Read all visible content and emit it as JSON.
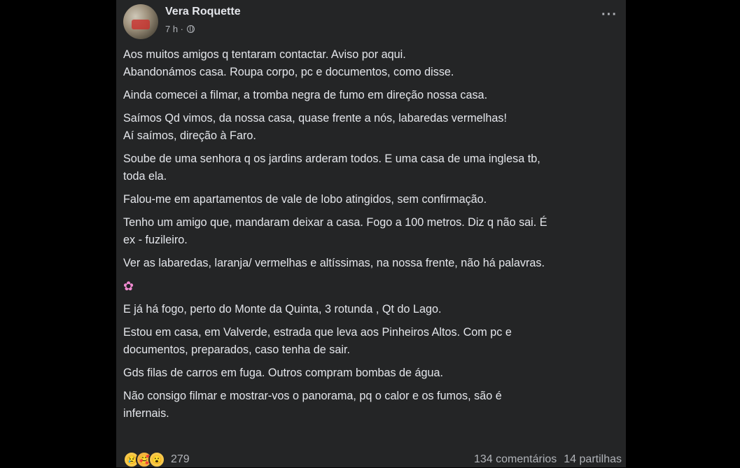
{
  "post": {
    "author": "Vera Roquette",
    "time": "7 h ·",
    "more_label": "···",
    "icons": {
      "avatar": "profile-photo",
      "privacy": "globe-icon",
      "reactions": [
        "sad-face-icon",
        "care-face-icon",
        "wow-face-icon"
      ],
      "section": "flower-icon"
    },
    "lines": [
      "Aos muitos amigos q tentaram contactar. Aviso por aqui.",
      "Abandonámos casa. Roupa corpo, pc e documentos, como disse.",
      "Ainda comecei a filmar, a tromba negra de fumo em direção nossa casa.",
      "Saímos Qd vimos, da nossa casa, quase frente a nós, labaredas vermelhas!",
      "Aí saímos, direção à Faro.",
      "Soube de uma senhora q os jardins arderam todos. E uma casa de uma inglesa tb,",
      "toda ela.",
      "Falou-me em apartamentos de vale de lobo atingidos, sem confirmação.",
      "Tenho um amigo que, mandaram deixar  a casa. Fogo a 100 metros. Diz q não sai. É",
      "ex - fuzileiro.",
      "Ver as labaredas, laranja/ vermelhas e altíssimas,  na nossa frente, não há palavras.",
      "✿",
      "E já  há fogo, perto do Monte da Quinta, 3 rotunda , Qt do Lago.",
      "Estou em casa, em Valverde, estrada que leva aos Pinheiros Altos. Com pc e",
      "documentos, preparados, caso tenha  de sair.",
      "Gds filas de carros em fuga. Outros compram bombas de água.",
      "Não consigo filmar e mostrar-vos o panorama, pq o calor  e os fumos,  são é",
      "infernais."
    ],
    "reaction_count": "279",
    "comments": "134 comentários",
    "shares": "14 partilhas"
  }
}
